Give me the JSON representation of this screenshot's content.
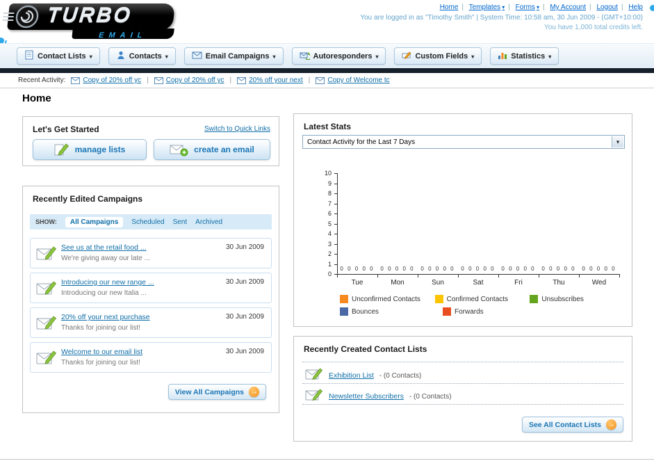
{
  "header": {
    "logo_title": "TURBO",
    "logo_subtitle": "EMAIL",
    "links": [
      {
        "label": "Home"
      },
      {
        "label": "Templates"
      },
      {
        "label": "Forms"
      },
      {
        "label": "My Account"
      },
      {
        "label": "Logout"
      },
      {
        "label": "Help"
      }
    ],
    "login_info": "You are logged in as \"Timothy Smith\" | System Time: 10:58 am, 30 Jun 2009 - (GMT+10:00)",
    "credits_info": "You have 1,000 total credits left."
  },
  "nav": {
    "tabs": [
      {
        "label": "Contact Lists"
      },
      {
        "label": "Contacts"
      },
      {
        "label": "Email Campaigns"
      },
      {
        "label": "Autoresponders"
      },
      {
        "label": "Custom Fields"
      },
      {
        "label": "Statistics"
      }
    ]
  },
  "recent_activity": {
    "label": "Recent Activity:",
    "items": [
      {
        "label": "Copy of 20% off yc"
      },
      {
        "label": "Copy of 20% off yc"
      },
      {
        "label": "20% off your next"
      },
      {
        "label": "Copy of Welcome tc"
      }
    ]
  },
  "page": {
    "title": "Home"
  },
  "get_started": {
    "title": "Let's Get Started",
    "switch_link": "Switch to Quick Links",
    "manage_lists_label": "manage lists",
    "create_email_label": "create an email"
  },
  "campaigns": {
    "title": "Recently Edited Campaigns",
    "show_label": "SHOW:",
    "filters": [
      {
        "label": "All Campaigns"
      },
      {
        "label": "Scheduled"
      },
      {
        "label": "Sent"
      },
      {
        "label": "Archived"
      }
    ],
    "items": [
      {
        "title": "See us at the retail food ...",
        "subtitle": "We're giving away our late ...",
        "date": "30 Jun 2009"
      },
      {
        "title": "Introducing our new range ...",
        "subtitle": "Introducing our new Italia ...",
        "date": "30 Jun 2009"
      },
      {
        "title": "20% off your next purchase",
        "subtitle": "Thanks for joining our list!",
        "date": "30 Jun 2009"
      },
      {
        "title": "Welcome to our email list",
        "subtitle": "Thanks for joining our list!",
        "date": "30 Jun 2009"
      }
    ],
    "view_all_label": "View All Campaigns"
  },
  "stats": {
    "title": "Latest Stats",
    "selected_option": "Contact Activity for the Last 7 Days",
    "chart_data": {
      "type": "bar",
      "title": "Contact Activity for the Last 7 Days",
      "categories": [
        "Tue",
        "Mon",
        "Sun",
        "Sat",
        "Fri",
        "Thu",
        "Wed"
      ],
      "series": [
        {
          "name": "Unconfirmed Contacts",
          "color": "#f6891f",
          "values": [
            0,
            0,
            0,
            0,
            0,
            0,
            0
          ]
        },
        {
          "name": "Confirmed Contacts",
          "color": "#fdc400",
          "values": [
            0,
            0,
            0,
            0,
            0,
            0,
            0
          ]
        },
        {
          "name": "Unsubscribes",
          "color": "#64a51f",
          "values": [
            0,
            0,
            0,
            0,
            0,
            0,
            0
          ]
        },
        {
          "name": "Bounces",
          "color": "#4a69a5",
          "values": [
            0,
            0,
            0,
            0,
            0,
            0,
            0
          ]
        },
        {
          "name": "Forwards",
          "color": "#e84e1f",
          "values": [
            0,
            0,
            0,
            0,
            0,
            0,
            0
          ]
        }
      ],
      "ylim": [
        0,
        10
      ],
      "yticks": [
        0,
        1,
        2,
        3,
        4,
        5,
        6,
        7,
        8,
        9,
        10
      ],
      "legend_position": "bottom",
      "grid": false
    }
  },
  "contact_lists": {
    "title": "Recently Created Contact Lists",
    "items": [
      {
        "name": "Exhibition List",
        "detail": "- (0 Contacts)"
      },
      {
        "name": "Newsletter Subscribers",
        "detail": "- (0 Contacts)"
      }
    ],
    "see_all_label": "See All Contact Lists"
  }
}
